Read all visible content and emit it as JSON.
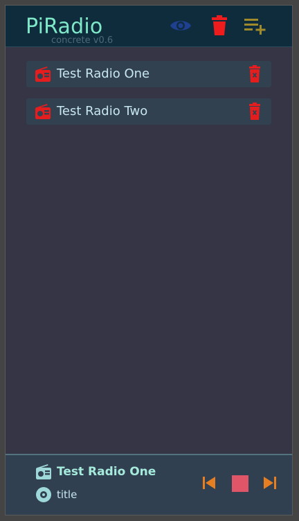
{
  "header": {
    "title": "PiRadio",
    "version": "concrete v0.6",
    "buttons": [
      {
        "icon": "eye-icon",
        "color": "#1f3f90"
      },
      {
        "icon": "trash-icon",
        "color": "#ee1c1c"
      },
      {
        "icon": "playlist-add-icon",
        "color": "#a08a2a"
      }
    ]
  },
  "stations": [
    {
      "name": "Test Radio One",
      "icon": "radio-icon",
      "delete_icon": "delete-icon"
    },
    {
      "name": "Test Radio Two",
      "icon": "radio-icon",
      "delete_icon": "delete-icon"
    }
  ],
  "player": {
    "station": "Test Radio One",
    "title": "title",
    "controls": [
      "skip-previous-icon",
      "stop-icon",
      "skip-next-icon"
    ]
  },
  "colors": {
    "accent_title": "#7fe8c8",
    "station_bg": "#314150",
    "station_text": "#c7e6ee",
    "station_icon": "#e41e1e",
    "player_bg": "#304050",
    "player_controls": "#e67e22",
    "stop_button": "#e05568",
    "background": "#353545"
  }
}
